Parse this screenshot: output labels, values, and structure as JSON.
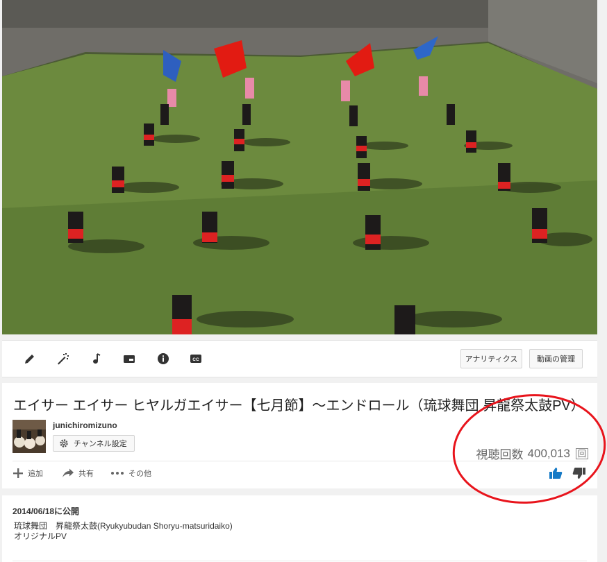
{
  "toolbar": {
    "icons": [
      "pencil-icon",
      "magic-wand-icon",
      "music-note-icon",
      "card-icon",
      "info-icon",
      "closed-captions-icon"
    ],
    "analytics_label": "アナリティクス",
    "manage_label": "動画の管理"
  },
  "video": {
    "title": "エイサー エイサー ヒヤルガエイサー【七月節】〜エンドロール（琉球舞団 昇龍祭太鼓PV）"
  },
  "channel": {
    "name": "junichiromizuno",
    "settings_label": "チャンネル設定"
  },
  "stats": {
    "views_label": "視聴回数",
    "views_count": "400,013",
    "views_unit": "回"
  },
  "actions": {
    "add_label": "追加",
    "share_label": "共有",
    "more_label": "その他"
  },
  "description": {
    "published": "2014/06/18に公開",
    "line1": "琉球舞団　昇龍祭太鼓(Ryukyubudan Shoryu-matsuridaiko)",
    "line2": "オリジナルPV"
  },
  "colors": {
    "like_active": "#167ac6",
    "annotation_red": "#e8141c",
    "grass": "#6c8a3e"
  }
}
